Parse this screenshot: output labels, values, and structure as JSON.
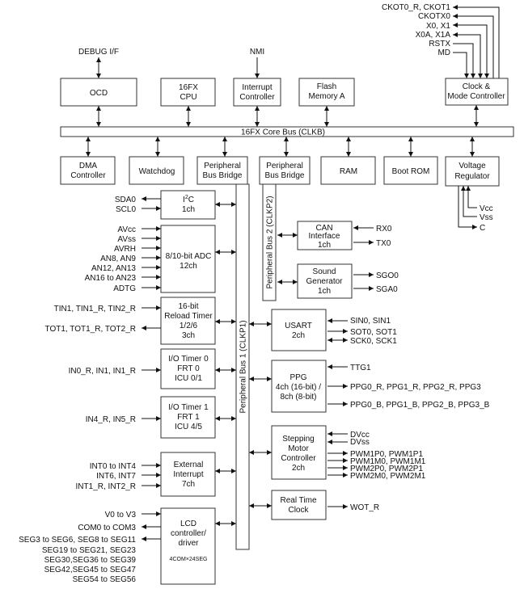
{
  "clock_signals": [
    "CKOT0_R, CKOT1",
    "CKOTX0",
    "X0, X1",
    "X0A, X1A",
    "RSTX",
    "MD"
  ],
  "top": {
    "debug": "DEBUG I/F",
    "nmi": "NMI",
    "ocd": "OCD",
    "cpu": [
      "16FX",
      "CPU"
    ],
    "intc": [
      "Interrupt",
      "Controller"
    ],
    "flash": [
      "Flash",
      "Memory A"
    ],
    "clock": [
      "Clock &",
      "Mode Controller"
    ]
  },
  "core_bus": "16FX Core Bus (CLKB)",
  "row2": {
    "dma": [
      "DMA",
      "Controller"
    ],
    "wd": "Watchdog",
    "pbb1": [
      "Peripheral",
      "Bus Bridge"
    ],
    "pbb2": [
      "Peripheral",
      "Bus Bridge"
    ],
    "ram": "RAM",
    "rom": "Boot ROM",
    "vreg": [
      "Voltage",
      "Regulator"
    ]
  },
  "power": [
    "Vcc",
    "Vss",
    "C"
  ],
  "bus1": "Peripheral Bus 1 (CLKP1)",
  "bus2": "Peripheral Bus 2 (CLKP2)",
  "left": {
    "i2c": {
      "title": [
        "I",
        "2",
        "C",
        "1ch"
      ],
      "sig": [
        "SDA0",
        "SCL0"
      ]
    },
    "adc": {
      "title": [
        "8/10-bit ADC",
        "12ch"
      ],
      "sig": [
        "AVcc",
        "AVss",
        "AVRH",
        "AN8, AN9",
        "AN12, AN13",
        "AN16 to AN23",
        "ADTG"
      ]
    },
    "rlt": {
      "title": [
        "16-bit",
        "Reload Timer",
        "1/2/6",
        "3ch"
      ],
      "sig": [
        "TIN1, TIN1_R, TIN2_R",
        "TOT1, TOT1_R, TOT2_R"
      ]
    },
    "io0": {
      "title": [
        "I/O Timer 0",
        "FRT 0",
        "ICU 0/1"
      ],
      "sig": [
        "IN0_R, IN1, IN1_R"
      ]
    },
    "io1": {
      "title": [
        "I/O Timer 1",
        "FRT 1",
        "ICU 4/5"
      ],
      "sig": [
        "IN4_R, IN5_R"
      ]
    },
    "ext": {
      "title": [
        "External",
        "Interrupt",
        "7ch"
      ],
      "sig": [
        "INT0 to INT4",
        "INT6, INT7",
        "INT1_R, INT2_R"
      ]
    },
    "lcd": {
      "title": [
        "LCD",
        "controller/",
        "driver",
        "4COM×24SEG"
      ],
      "sig": [
        "V0 to V3",
        "COM0 to COM3",
        "SEG3 to SEG6, SEG8 to SEG11",
        "SEG19 to SEG21, SEG23",
        "SEG30,SEG36 to SEG39",
        "SEG42,SEG45 to SEG47",
        "SEG54 to SEG56"
      ]
    }
  },
  "right": {
    "can": {
      "title": [
        "CAN",
        "Interface",
        "1ch"
      ],
      "sig": [
        "RX0",
        "TX0"
      ]
    },
    "snd": {
      "title": [
        "Sound",
        "Generator",
        "1ch"
      ],
      "sig": [
        "SGO0",
        "SGA0"
      ]
    },
    "usart": {
      "title": [
        "USART",
        "2ch"
      ],
      "sig": [
        "SIN0, SIN1",
        "SOT0, SOT1",
        "SCK0, SCK1"
      ]
    },
    "ppg": {
      "title": [
        "PPG",
        "4ch (16-bit) /",
        "8ch (8-bit)"
      ],
      "sig": [
        "TTG1",
        "PPG0_R, PPG1_R, PPG2_R, PPG3",
        "PPG0_B, PPG1_B, PPG2_B, PPG3_B"
      ]
    },
    "smc": {
      "title": [
        "Stepping",
        "Motor",
        "Controller",
        "2ch"
      ],
      "sig": [
        "DVcc",
        "DVss",
        "PWM1P0, PWM1P1",
        "PWM1M0, PWM1M1",
        "PWM2P0, PWM2P1",
        "PWM2M0, PWM2M1"
      ]
    },
    "rtc": {
      "title": [
        "Real Time",
        "Clock"
      ],
      "sig": [
        "WOT_R"
      ]
    }
  }
}
